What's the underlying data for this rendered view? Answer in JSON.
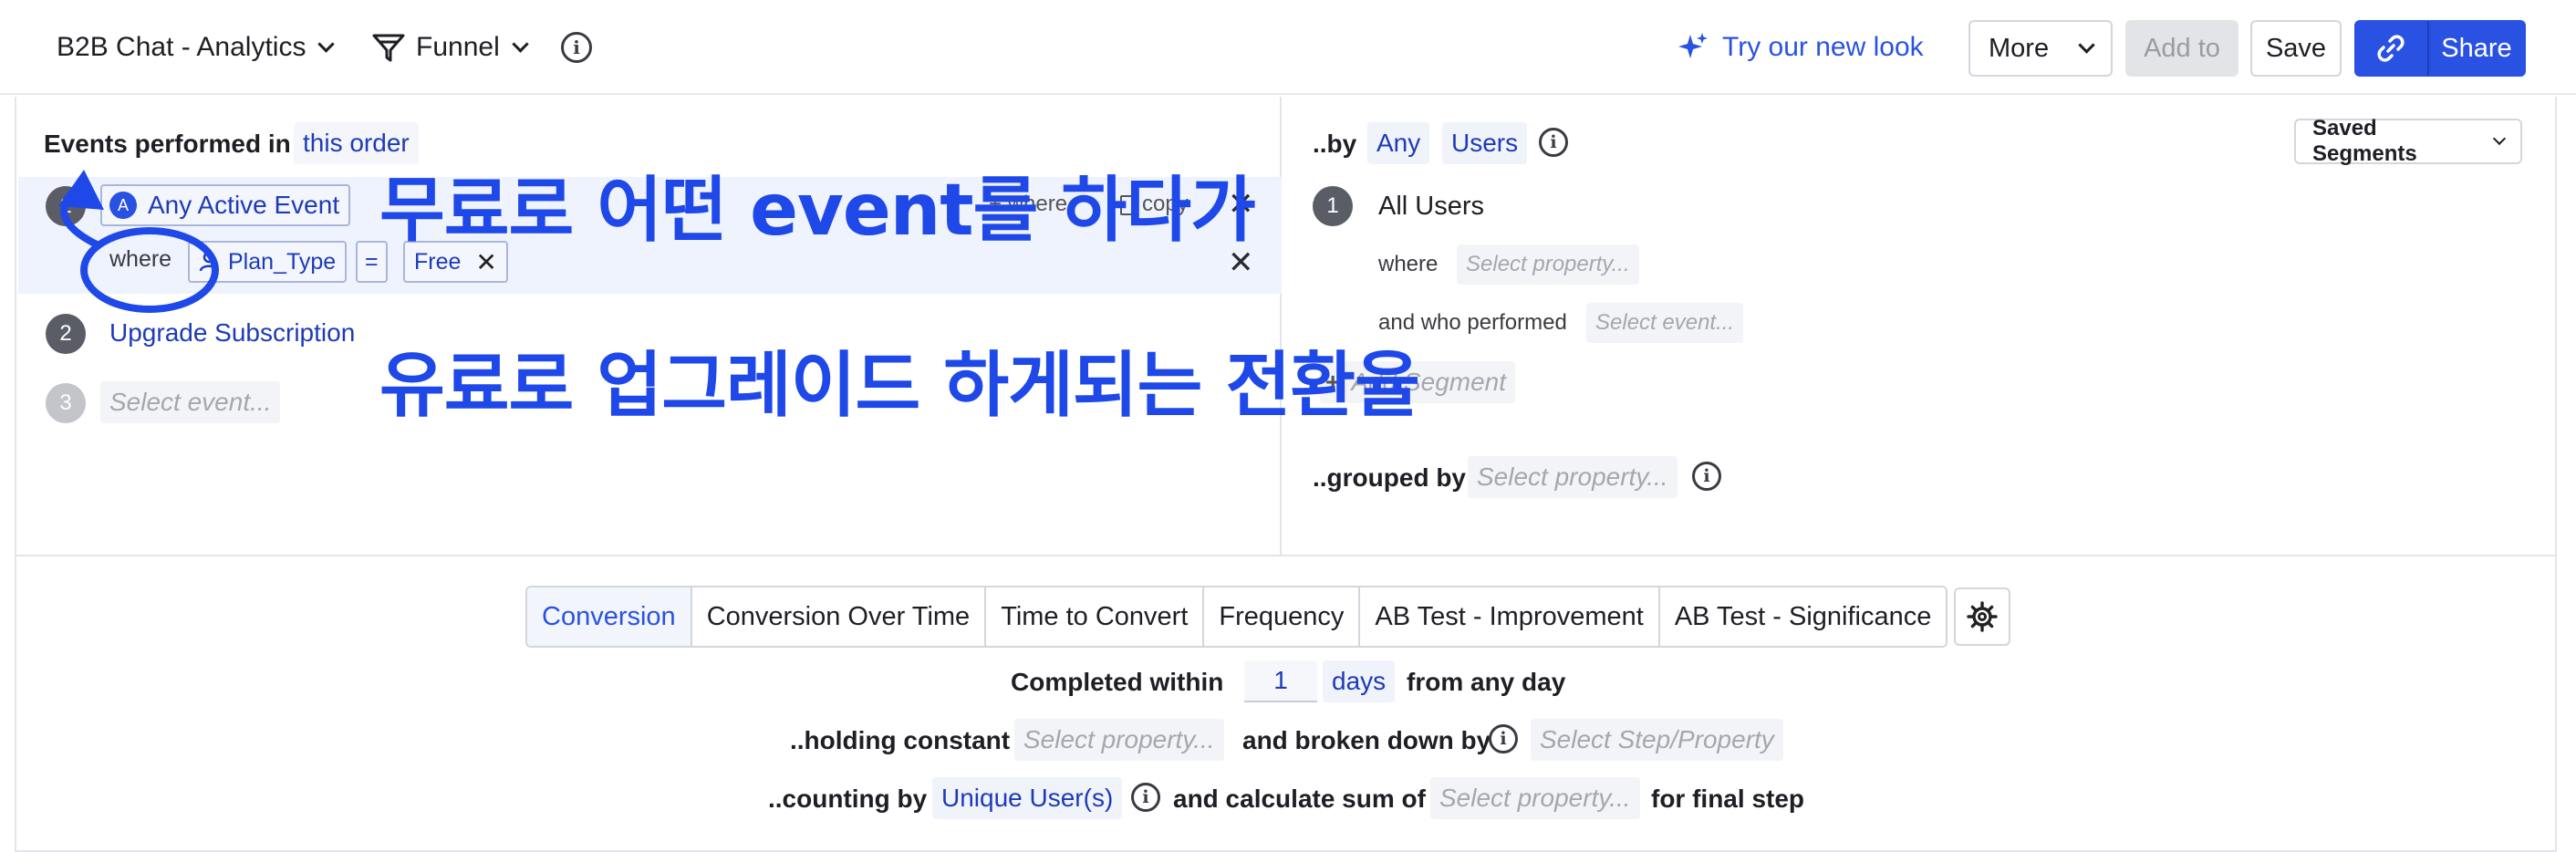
{
  "header": {
    "project": "B2B Chat - Analytics",
    "chart_type": "Funnel",
    "try_new_look": "Try our new look",
    "more": "More",
    "add_to": "Add to",
    "save": "Save",
    "share": "Share"
  },
  "events": {
    "title": "Events performed in",
    "order": "this order",
    "steps": [
      {
        "num": "1",
        "label": "Any Active Event"
      },
      {
        "num": "2",
        "label": "Upgrade Subscription"
      },
      {
        "num": "3",
        "label": "Select event..."
      }
    ],
    "filter": {
      "where": "where",
      "property": "Plan_Type",
      "operator": "=",
      "value": "Free"
    },
    "step_actions": {
      "where": "where",
      "copy": "copy"
    }
  },
  "segments": {
    "by_label": "..by",
    "any": "Any",
    "users": "Users",
    "saved_segments": "Saved Segments",
    "segment_num": "1",
    "segment_name": "All Users",
    "where": "where",
    "where_placeholder": "Select property...",
    "who_performed": "and who performed",
    "event_placeholder": "Select event...",
    "add_segment": "Add Segment",
    "grouped_by": "..grouped by",
    "grouped_placeholder": "Select property..."
  },
  "annotations": {
    "line1": "무료로 어떤 event를 하다가",
    "line2": "유료로 업그레이드 하게되는 전환율"
  },
  "bottom": {
    "tabs": [
      "Conversion",
      "Conversion Over Time",
      "Time to Convert",
      "Frequency",
      "AB Test - Improvement",
      "AB Test - Significance"
    ],
    "completed_within": "Completed within",
    "within_value": "1",
    "within_unit": "days",
    "from_any_day": "from any day",
    "holding_constant": "..holding constant",
    "holding_placeholder": "Select property...",
    "broken_down_by": "and broken down by",
    "broken_placeholder": "Select Step/Property",
    "counting_by": "..counting by",
    "counting_value": "Unique User(s)",
    "calculate_sum": "and calculate sum of",
    "sum_placeholder": "Select property...",
    "final_step": "for final step"
  },
  "colors": {
    "accent": "#2952e3",
    "annotation": "#1f48e8"
  }
}
